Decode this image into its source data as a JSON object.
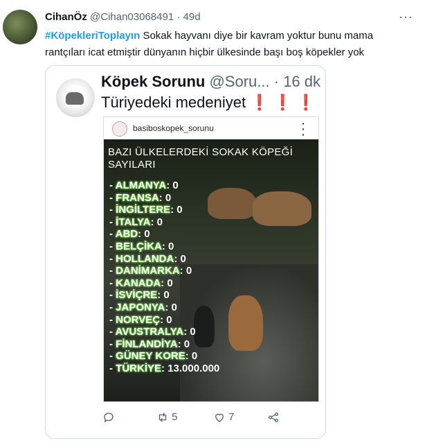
{
  "tweet": {
    "author_name": "CihanÖz",
    "handle": "@Cihan03068491",
    "separator": "·",
    "time": "49d",
    "hashtag": "#KöpekleriToplayın",
    "text": "Sokak hayvanı diye bir kavram yoktur bunu mama rantçıları icat etmiştir dünyanın hiçbir ülkesinde başı boş köpekler yok",
    "more_icon": "more-icon"
  },
  "quoted": {
    "author_name": "Köpek Sorunu",
    "handle": "@Soru...",
    "separator": "·",
    "time": "16 dk",
    "text": "Türiyedeki medeniyet",
    "exclamations": "❗❗❗",
    "instagram": {
      "username": "basiboskopek_sorunu",
      "title": "BAZI ÜLKELERDEKİ SOKAK KÖPEĞİ SAYILARI",
      "rows": [
        {
          "country": "ALMANYA",
          "count": ": 0"
        },
        {
          "country": "FRANSA",
          "count": ": 0"
        },
        {
          "country": "İNGİLTERE",
          "count": ": 0"
        },
        {
          "country": "İTALYA",
          "count": ": 0"
        },
        {
          "country": "ABD",
          "count": ": 0"
        },
        {
          "country": "BELÇİKA",
          "count": ": 0"
        },
        {
          "country": "HOLLANDA",
          "count": ": 0"
        },
        {
          "country": "DANİMARKA",
          "count": ": 0"
        },
        {
          "country": "KANADA",
          "count": ": 0"
        },
        {
          "country": "İSVİÇRE",
          "count": ": 0"
        },
        {
          "country": "JAPONYA",
          "count": ": 0"
        },
        {
          "country": "NORVEÇ",
          "count": ": 0"
        },
        {
          "country": "AVUSTRALYA",
          "count": ": 0"
        },
        {
          "country": "FİNLANDİYA",
          "count": ": 0"
        },
        {
          "country": "GÜNEY KORE",
          "count": ": 0"
        },
        {
          "country": "TÜRKİYE",
          "count": ": 13.000.000"
        }
      ]
    },
    "actions": {
      "reply_count": "",
      "retweet_count": "5",
      "like_count": "7"
    }
  },
  "colors": {
    "link": "#1d9bf0",
    "secondary_text": "#536471",
    "exclamation": "#d42020"
  }
}
